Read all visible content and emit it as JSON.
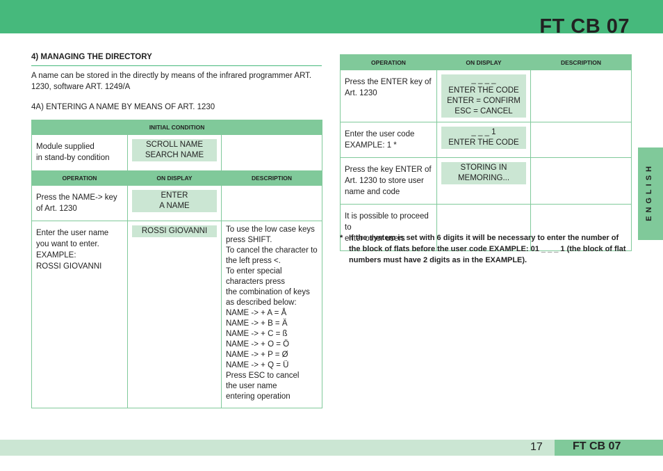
{
  "header": {
    "title": "FT CB 07",
    "color": "#46b97c"
  },
  "section": {
    "title": "4) MANAGING THE DIRECTORY",
    "intro": "A name can be stored in the directly by means of the infrared programmer ART. 1230, software ART. 1249/A",
    "subtitle": "4A) ENTERING A NAME BY MEANS OF ART. 1230"
  },
  "left_table": {
    "initial_header": "INITIAL CONDITION",
    "initial_row": {
      "op": [
        "Module supplied",
        "in stand-by condition"
      ],
      "display": [
        "SCROLL NAME",
        "SEARCH NAME"
      ],
      "desc": ""
    },
    "columns": [
      "OPERATION",
      "ON DISPLAY",
      "DESCRIPTION"
    ],
    "rows": [
      {
        "op": [
          "Press the NAME-> key",
          "of Art. 1230"
        ],
        "display": [
          "ENTER",
          "A NAME"
        ],
        "desc": []
      },
      {
        "op": [
          "Enter the user name",
          "you want to enter.",
          "EXAMPLE:",
          "ROSSI GIOVANNI"
        ],
        "display": [
          "ROSSI GIOVANNI"
        ],
        "desc": [
          "To use the low case keys",
          "press SHIFT.",
          "To cancel the character to",
          "the left press <.",
          "To enter special",
          "characters press",
          "the combination of keys",
          "as described below:",
          "NAME -> + A = Å",
          "NAME -> + B = Ä",
          "NAME -> + C = ß",
          "NAME -> + O = Ö",
          "NAME -> + P = Ø",
          "NAME -> + Q = Ü",
          "Press ESC to cancel",
          "the user name",
          "entering operation"
        ]
      }
    ]
  },
  "right_table": {
    "columns": [
      "OPERATION",
      "ON DISPLAY",
      "DESCRIPTION"
    ],
    "rows": [
      {
        "op": [
          "Press the ENTER key of",
          "Art. 1230"
        ],
        "display": [
          "_ _ _ _",
          "ENTER THE CODE",
          "ENTER = CONFIRM",
          "ESC = CANCEL"
        ]
      },
      {
        "op": [
          "Enter the user code",
          "EXAMPLE: 1 *"
        ],
        "display": [
          "_ _ _ 1",
          "ENTER THE CODE"
        ]
      },
      {
        "op": [
          "Press the key ENTER of",
          "Art. 1230 to store user",
          "name and code"
        ],
        "display": [
          "STORING IN",
          "MEMORING..."
        ]
      },
      {
        "op": [
          "It is possible to proceed to",
          "enter other users"
        ],
        "display": []
      }
    ]
  },
  "note": {
    "star": "*",
    "text": "If the system is set with 6 digits it will be necessary to enter the number of the block of flats before the user code EXAMPLE: 01 _ _ _ 1 (the block of flat numbers must have 2 digits as in the EXAMPLE)."
  },
  "side_tab": "ENGLISH",
  "footer": {
    "page": "17",
    "title": "FT CB 07"
  }
}
